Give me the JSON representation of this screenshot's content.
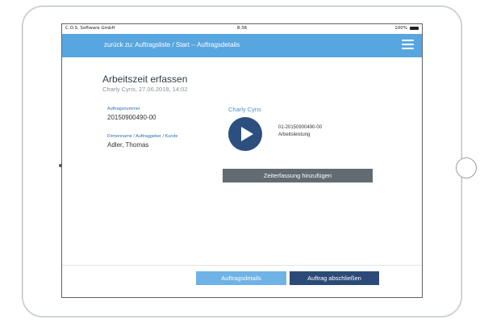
{
  "status_bar": {
    "carrier": "C.O.S. Software GmbH",
    "time": "8:36",
    "battery": "100%"
  },
  "navbar": {
    "breadcrumb": "zurück zu: Auftragsliste / Start -- Auftragsdetails",
    "menu_icon": "hamburger-menu-icon"
  },
  "header": {
    "title": "Arbeitszeit erfassen",
    "subtitle": "Charly Cyris, 27.06.2018, 14:02"
  },
  "order": {
    "number_label": "Auftragsnummer",
    "number_value": "20150900490-00",
    "company_label": "Firmenname / Auftraggeber / Kunde",
    "company_value": "Adler, Thomas"
  },
  "timer": {
    "worker_name": "Charly Cyris",
    "play_icon": "play-icon",
    "order_ref": "01-20150900490-00",
    "order_type": "Arbeitsleistung",
    "add_button": "Zeiterfassung hinzufügen"
  },
  "footer": {
    "details_button": "Auftragsdetails",
    "close_button": "Auftrag abschließen"
  },
  "colors": {
    "navbar": "#58a6e0",
    "primary_dark": "#2c4a78",
    "secondary_button": "#6fb2e6",
    "gray_button": "#636b72"
  }
}
